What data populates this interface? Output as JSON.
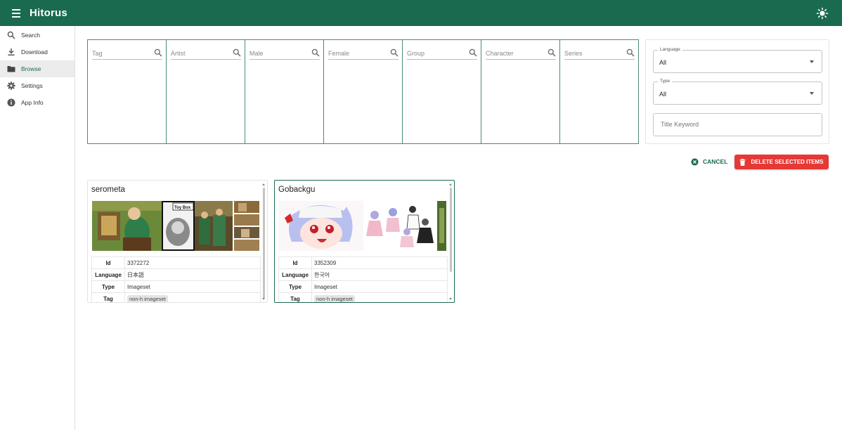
{
  "app": {
    "title": "Hitorus"
  },
  "sidebar": {
    "items": [
      {
        "label": "Search",
        "icon": "search-icon",
        "active": false
      },
      {
        "label": "Download",
        "icon": "download-icon",
        "active": false
      },
      {
        "label": "Browse",
        "icon": "folder-icon",
        "active": true
      },
      {
        "label": "Settings",
        "icon": "gear-icon",
        "active": false
      },
      {
        "label": "App Info",
        "icon": "info-icon",
        "active": false
      }
    ]
  },
  "filters": {
    "tag": {
      "placeholder": "Tag"
    },
    "artist": {
      "placeholder": "Artist"
    },
    "male": {
      "placeholder": "Male"
    },
    "female": {
      "placeholder": "Female"
    },
    "group": {
      "placeholder": "Group"
    },
    "character": {
      "placeholder": "Character"
    },
    "series": {
      "placeholder": "Series"
    }
  },
  "options": {
    "language": {
      "label": "Language",
      "value": "All"
    },
    "type": {
      "label": "Type",
      "value": "All"
    },
    "title_keyword": {
      "placeholder": "Title Keyword"
    }
  },
  "actions": {
    "cancel_label": "CANCEL",
    "delete_label": "DELETE SELECTED ITEMS"
  },
  "table_keys": {
    "id": "Id",
    "language": "Language",
    "type": "Type",
    "tag": "Tag"
  },
  "galleries": [
    {
      "title": "serometa",
      "id": "3372272",
      "language": "日本語",
      "type": "Imageset",
      "tag": "non-h imageset",
      "selected": false,
      "thumb_caption": "Toy Box"
    },
    {
      "title": "Gobackgu",
      "id": "3352309",
      "language": "한국어",
      "type": "Imageset",
      "tag": "non-h imageset",
      "selected": true
    }
  ],
  "colors": {
    "primary": "#1a6a4f",
    "danger": "#e53935"
  }
}
